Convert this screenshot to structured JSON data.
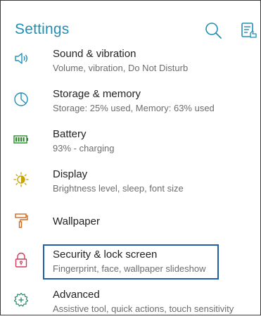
{
  "header": {
    "title": "Settings",
    "icons": [
      "search-icon",
      "tips-icon"
    ],
    "accent_color": "#1f8fb5"
  },
  "items": [
    {
      "label": "Sound & vibration",
      "subtitle": "Volume, vibration, Do Not Disturb",
      "icon": "speaker-icon"
    },
    {
      "label": "Storage & memory",
      "subtitle": "Storage: 25% used, Memory: 63% used",
      "icon": "storage-icon"
    },
    {
      "label": "Battery",
      "subtitle": "93% - charging",
      "icon": "battery-icon"
    },
    {
      "label": "Display",
      "subtitle": "Brightness level, sleep, font size",
      "icon": "brightness-icon"
    },
    {
      "label": "Wallpaper",
      "subtitle": "",
      "icon": "paint-roller-icon"
    },
    {
      "label": "Security & lock screen",
      "subtitle": "Fingerprint, face, wallpaper slideshow",
      "icon": "lock-icon"
    },
    {
      "label": "Advanced",
      "subtitle": "Assistive tool, quick actions, touch sensitivity",
      "icon": "gear-plus-icon"
    }
  ],
  "highlighted_item": "Security & lock screen",
  "highlight_color": "#1f5ea8"
}
